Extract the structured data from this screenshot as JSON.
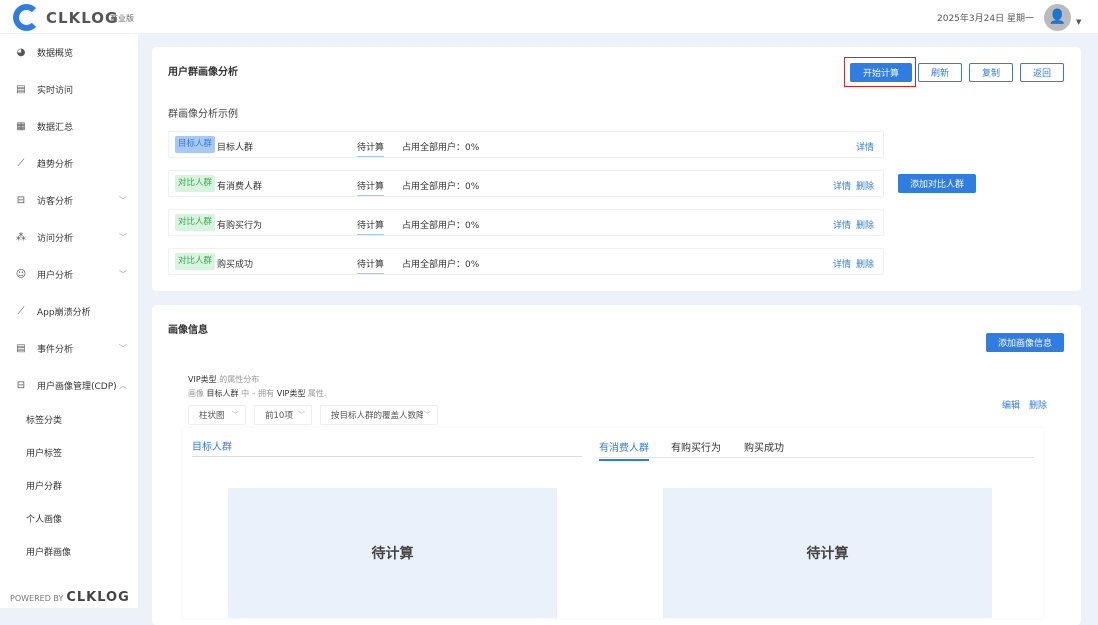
{
  "header": {
    "logo": "CLKLOG",
    "edition": "商业版",
    "date": "2025年3月24日 星期一"
  },
  "sidebar": {
    "items": [
      {
        "label": "数据概览",
        "icon": "dashboard-icon"
      },
      {
        "label": "实时访问",
        "icon": "realtime-icon"
      },
      {
        "label": "数据汇总",
        "icon": "summary-icon"
      },
      {
        "label": "趋势分析",
        "icon": "trend-icon"
      },
      {
        "label": "访客分析",
        "icon": "visitor-icon",
        "chevron": "﹀"
      },
      {
        "label": "访问分析",
        "icon": "access-icon",
        "chevron": "﹀"
      },
      {
        "label": "用户分析",
        "icon": "user-icon",
        "chevron": "﹀"
      },
      {
        "label": "App崩溃分析",
        "icon": "crash-icon"
      },
      {
        "label": "事件分析",
        "icon": "event-icon",
        "chevron": "﹀"
      },
      {
        "label": "用户画像管理(CDP)",
        "icon": "cdp-icon",
        "chevron": "︿"
      }
    ],
    "subitems": [
      "标签分类",
      "用户标签",
      "用户分群",
      "个人画像",
      "用户群画像"
    ],
    "powered": "POWERED BY",
    "powered_logo": "CLKLOG"
  },
  "analysis": {
    "title": "用户群画像分析",
    "buttons": {
      "start": "开始计算",
      "refresh": "刷新",
      "copy": "复制",
      "back": "返回"
    },
    "subtitle": "群画像分析示例",
    "rows": [
      {
        "tag": "目标人群",
        "type": "t",
        "name": "目标人群",
        "status": "待计算",
        "share": "占用全部用户：0%",
        "detail": "详情"
      },
      {
        "tag": "对比人群",
        "type": "c",
        "name": "有消费人群",
        "status": "待计算",
        "share": "占用全部用户：0%",
        "detail": "详情",
        "delete": "删除"
      },
      {
        "tag": "对比人群",
        "type": "c",
        "name": "有购买行为",
        "status": "待计算",
        "share": "占用全部用户：0%",
        "detail": "详情",
        "delete": "删除"
      },
      {
        "tag": "对比人群",
        "type": "c",
        "name": "购买成功",
        "status": "待计算",
        "share": "占用全部用户：0%",
        "detail": "详情",
        "delete": "删除"
      }
    ],
    "add_compare": "添加对比人群"
  },
  "profile": {
    "title": "画像信息",
    "add": "添加画像信息",
    "attr_name": "VIP类型",
    "attr_suffix": " 的属性分布",
    "desc_prefix": "画像 ",
    "desc_group": "目标人群",
    "desc_mid": " 中 – 拥有 ",
    "desc_attr": "VIP类型",
    "desc_end": " 属性.",
    "edit": "编辑",
    "delete": "删除",
    "selects": [
      "柱状图",
      "前10项",
      "按目标人群的覆盖人数降序"
    ],
    "left_tab": "目标人群",
    "tabs": [
      "有消费人群",
      "有购买行为",
      "购买成功"
    ],
    "pending": "待计算"
  }
}
